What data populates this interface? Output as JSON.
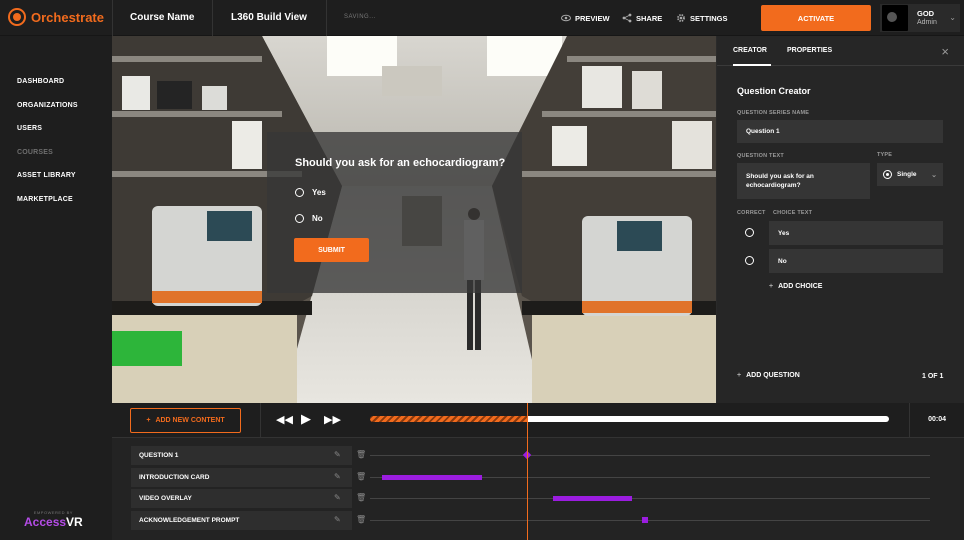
{
  "app": {
    "name": "Orchestrate"
  },
  "header": {
    "course_name": "Course Name",
    "view_name": "L360 Build View",
    "status": "SAVING...",
    "preview_label": "PREVIEW",
    "share_label": "SHARE",
    "settings_label": "SETTINGS",
    "activate_label": "ACTIVATE",
    "user_name": "GOD",
    "user_role": "Admin"
  },
  "sidebar": {
    "items": [
      {
        "label": "DASHBOARD",
        "enabled": true
      },
      {
        "label": "ORGANIZATIONS",
        "enabled": true
      },
      {
        "label": "USERS",
        "enabled": true
      },
      {
        "label": "COURSES",
        "enabled": false
      },
      {
        "label": "ASSET LIBRARY",
        "enabled": true
      },
      {
        "label": "MARKETPLACE",
        "enabled": true
      }
    ],
    "brand_small": "EMPOWERED BY",
    "brand_access": "Access",
    "brand_vr": "VR"
  },
  "overlay": {
    "question": "Should you ask for an echocardiogram?",
    "options": [
      "Yes",
      "No"
    ],
    "submit_label": "SUBMIT"
  },
  "panel": {
    "tabs": [
      "CREATOR",
      "PROPERTIES"
    ],
    "active_tab": "CREATOR",
    "title": "Question Creator",
    "series_name_label": "QUESTION SERIES NAME",
    "series_name_value": "Question 1",
    "question_text_label": "QUESTION TEXT",
    "question_text_value": "Should you ask for an echocardiogram?",
    "type_label": "TYPE",
    "type_value": "Single",
    "correct_label": "CORRECT",
    "choice_text_label": "CHOICE TEXT",
    "choices": [
      "Yes",
      "No"
    ],
    "add_choice_label": "ADD CHOICE",
    "add_question_label": "ADD QUESTION",
    "pagination": "1 OF 1"
  },
  "controls": {
    "add_content_label": "ADD NEW CONTENT",
    "time": "00:04",
    "progress": 0.3
  },
  "timeline": {
    "tracks": [
      {
        "label": "QUESTION 1"
      },
      {
        "label": "INTRODUCTION CARD"
      },
      {
        "label": "VIDEO OVERLAY"
      },
      {
        "label": "ACKNOWLEDGEMENT PROMPT"
      }
    ]
  },
  "colors": {
    "accent": "#f26b1d",
    "track": "#9b1de0",
    "brand_vr": "#b44ce6"
  }
}
